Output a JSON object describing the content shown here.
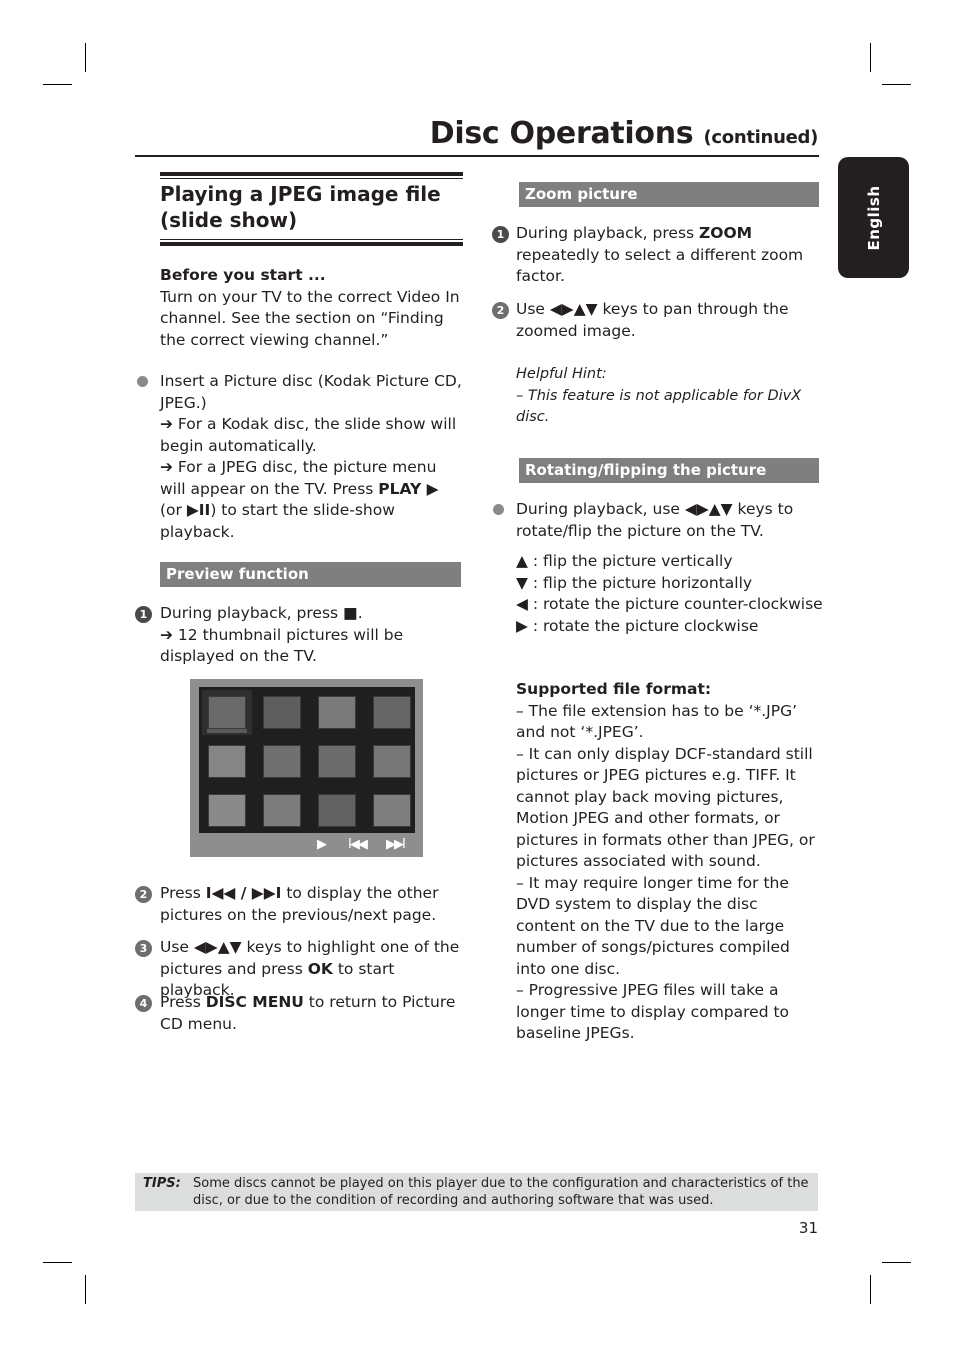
{
  "header": {
    "title": "Disc Operations",
    "title_suffix": "(continued)",
    "language_tab": "English"
  },
  "left": {
    "section_title_line1": "Playing a JPEG image file",
    "section_title_line2": "(slide show)",
    "before_heading": "Before you start ...",
    "before_text": "Turn on your TV to the correct Video In channel.  See the section on “Finding the correct viewing channel.”",
    "bullet1": {
      "text": "Insert a Picture disc (Kodak Picture CD, JPEG.)",
      "result1": "➔ For a Kodak disc, the slide show will begin automatically.",
      "result2_pre": "➔ For a JPEG disc, the picture menu will appear on the TV.  Press ",
      "result2_key": "PLAY ▶",
      "result2_mid": " (or ",
      "result2_key2": "▶II",
      "result2_post": ") to start the slide-show playback."
    },
    "preview_bar": "Preview function",
    "steps": [
      {
        "num": "1",
        "pre": "During playback, press ",
        "key": "■",
        "post": ".",
        "result": "➔ 12 thumbnail pictures will be displayed on the TV."
      },
      {
        "num": "2",
        "pre": "Press ",
        "key": "I◀◀ / ▶▶I",
        "post": " to display the other pictures on the previous/next page."
      },
      {
        "num": "3",
        "pre": "Use ",
        "key": "◀▶▲▼",
        "post": " keys to highlight one of the pictures and press ",
        "key2": "OK",
        "post2": " to start playback."
      },
      {
        "num": "4",
        "pre": "Press ",
        "key": "DISC MENU",
        "post": " to return to Picture CD menu."
      }
    ],
    "tv_screen": {
      "thumbnail_count": 12,
      "controls": [
        "▶",
        "I◀◀",
        "▶▶I"
      ]
    }
  },
  "right": {
    "zoom_bar": "Zoom picture",
    "zoom_steps": [
      {
        "num": "1",
        "pre": "During playback, press ",
        "key": "ZOOM",
        "post": " repeatedly to select a different zoom factor."
      },
      {
        "num": "2",
        "pre": "Use ",
        "key": "◀▶▲▼",
        "post": " keys to pan through the zoomed image."
      }
    ],
    "hint_title": "Helpful Hint:",
    "hint_text": "–  This feature is not applicable for DivX disc.",
    "rotate_bar": "Rotating/flipping the picture",
    "rotate_bullet_pre": "During playback, use ",
    "rotate_bullet_key": "◀▶▲▼",
    "rotate_bullet_post": " keys to rotate/flip the picture on the TV.",
    "rotate_items": [
      {
        "key": "▲",
        "text": " : flip the picture vertically"
      },
      {
        "key": "▼",
        "text": " : flip the picture horizontally"
      },
      {
        "key": "◀",
        "text": " : rotate the picture counter-clockwise"
      },
      {
        "key": "▶",
        "text": " : rotate the picture clockwise"
      }
    ],
    "format_heading": "Supported file format:",
    "format_items": [
      "–   The file extension has to be ‘*.JPG’ and not ‘*.JPEG’.",
      "–   It can only display DCF-standard still pictures or JPEG pictures e.g. TIFF.  It cannot play back moving pictures, Motion JPEG and other formats, or pictures in formats other than JPEG, or pictures associated with sound.",
      "–   It may require longer time for the DVD system to display the disc content on the TV due to the large number of songs/pictures compiled into one disc.",
      "–   Progressive JPEG files will take a longer time to display compared to baseline JPEGs."
    ]
  },
  "footer": {
    "tips_label": "TIPS:",
    "tips_text": "Some discs cannot be played on this player due to the configuration and characteristics of the disc, or due to the condition of recording and authoring software that was used.",
    "page_number": "31"
  }
}
